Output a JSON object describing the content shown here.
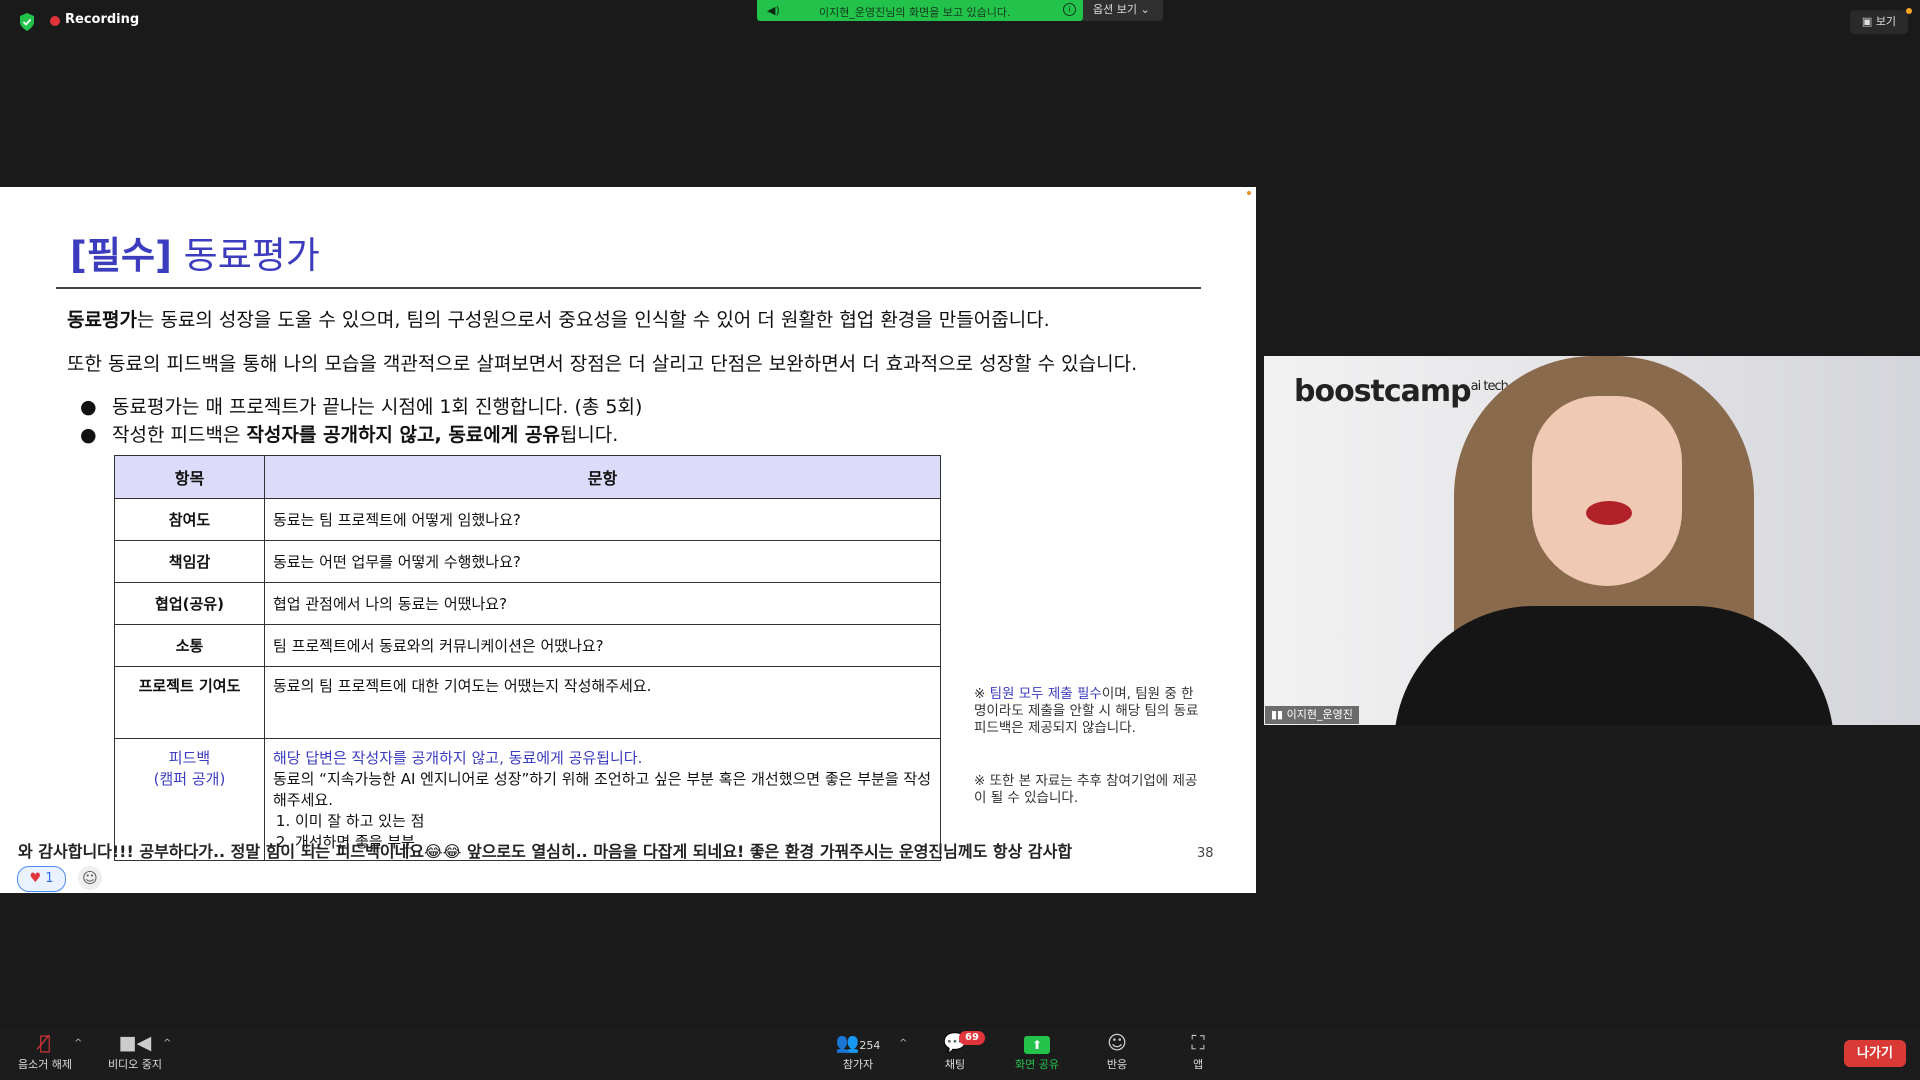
{
  "topbar": {
    "recording_label": "Recording",
    "share_banner": "이지현_운영진님의 화면을 보고 있습니다.",
    "options_label": "옵션 보기",
    "view_label": "보기"
  },
  "slide": {
    "title_bracket": "[필수]",
    "title_rest": " 동료평가",
    "p1_bold": "동료평가",
    "p1_rest": "는 동료의 성장을 도울 수 있으며, 팀의 구성원으로서 중요성을 인식할 수 있어 더 원활한 협업 환경을 만들어줍니다.",
    "p2": "또한 동료의 피드백을 통해 나의 모습을 객관적으로 살펴보면서 장점은 더 살리고 단점은 보완하면서 더 효과적으로 성장할 수 있습니다.",
    "bullet1": "동료평가는 매 프로젝트가 끝나는 시점에 1회 진행합니다. (총 5회)",
    "bullet2_pre": "작성한 피드백은 ",
    "bullet2_bold": "작성자를 공개하지 않고, 동료에게 공유",
    "bullet2_post": "됩니다.",
    "table": {
      "header_item": "항목",
      "header_question": "문항",
      "rows": [
        {
          "item": "참여도",
          "question": "동료는 팀 프로젝트에 어떻게 임했나요?"
        },
        {
          "item": "책임감",
          "question": "동료는 어떤 업무를 어떻게 수행했나요?"
        },
        {
          "item": "협업(공유)",
          "question": "협업 관점에서 나의 동료는 어땠나요?"
        },
        {
          "item": "소통",
          "question": "팀 프로젝트에서 동료와의 커뮤니케이션은 어땠나요?"
        },
        {
          "item": "프로젝트 기여도",
          "question": "동료의 팀 프로젝트에 대한 기여도는 어땠는지 작성해주세요."
        }
      ],
      "feedback": {
        "item_line1": "피드백",
        "item_line2": "(캠퍼 공개)",
        "lead": "해당 답변은 작성자를 공개하지 않고, 동료에게 공유됩니다.",
        "body": "동료의 “지속가능한 AI 엔지니어로 성장”하기 위해 조언하고 싶은 부분 혹은 개선했으면 좋은 부분을 작성해주세요.",
        "list1": "이미 잘 하고 있는 점",
        "list2": "개선하면 좋을 부분"
      }
    },
    "note1_pre": "※ ",
    "note1_hl": "팀원 모두 제출 필수",
    "note1_post": "이며, 팀원 중 한명이라도 제출을 안할 시 해당 팀의 동료 피드백은 제공되지 않습니다.",
    "note2": "※ 또한 본 자료는 추후 참여기업에 제공이 될 수 있습니다.",
    "page_number": "38"
  },
  "reaction": {
    "message": "와 감사합니다!!! 공부하다가.. 정말 힘이 되는 피드백이네요😂😂 앞으로도 열심히.. 마음을 다잡게 되네요! 좋은 환경 가꿔주시는 운영진님께도 항상 감사합",
    "heart_count": "1"
  },
  "video": {
    "logo_text": "boostcamp",
    "logo_sup": "ai tech",
    "name_tag": "이지현_운영진"
  },
  "toolbar": {
    "mute_label": "음소거 해제",
    "video_label": "비디오 중지",
    "participants_label": "참가자",
    "participants_count": "254",
    "chat_label": "채팅",
    "chat_badge": "69",
    "share_label": "화면 공유",
    "reactions_label": "반응",
    "apps_label": "앱",
    "leave_label": "나가기"
  },
  "colors": {
    "accent_purple": "#3c3cbf",
    "share_green": "#23c24b",
    "leave_red": "#d93a35"
  }
}
